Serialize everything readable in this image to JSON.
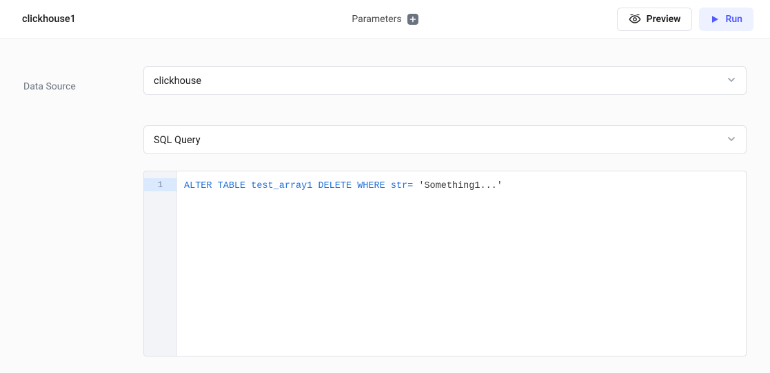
{
  "header": {
    "title": "clickhouse1",
    "parameters_label": "Parameters",
    "preview_label": "Preview",
    "run_label": "Run"
  },
  "form": {
    "data_source_label": "Data Source",
    "data_source_value": "clickhouse",
    "query_type_value": "SQL Query"
  },
  "editor": {
    "lines": [
      "1"
    ],
    "sql": {
      "kw1": "ALTER",
      "kw2": "TABLE",
      "ident": "test_array1",
      "kw3": "DELETE",
      "kw4": "WHERE",
      "col": "str",
      "op": "=",
      "str": "'Something1...'"
    }
  }
}
